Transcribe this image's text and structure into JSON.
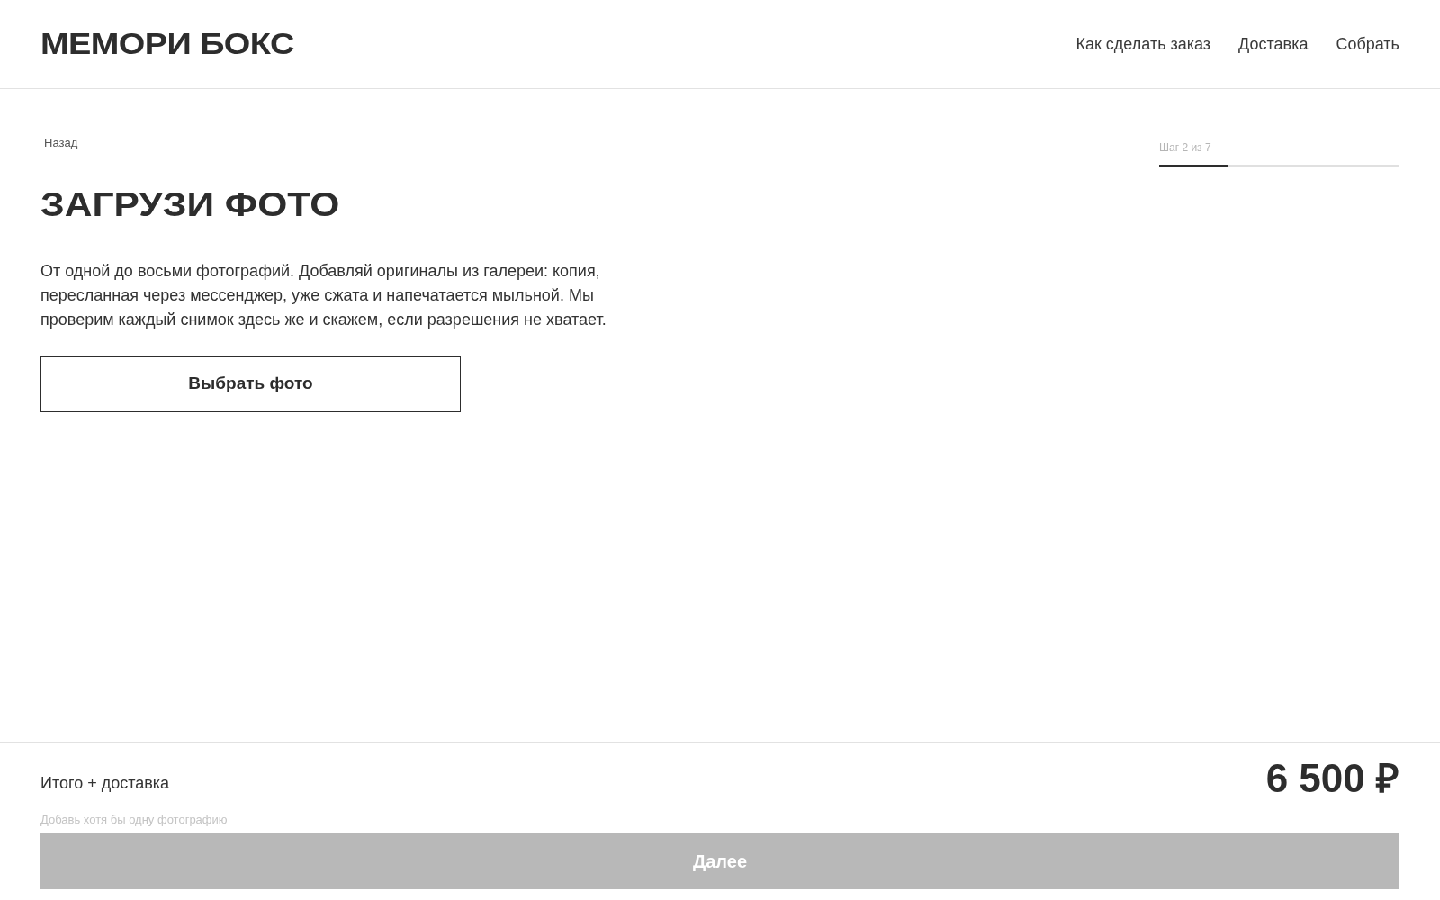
{
  "header": {
    "logo": "МЕМОРИ БОКС",
    "nav": [
      "Как сделать заказ",
      "Доставка",
      "Собрать"
    ]
  },
  "back_link": "Назад",
  "progress": {
    "label": "Шаг 2 из 7",
    "level": 0.2857
  },
  "title": "ЗАГРУЗИ ФОТО",
  "description": "От одной до восьми фотографий. Добавляй оригиналы из галереи: копия, пересланная через мессенджер, уже сжата и напечатается мыльной. Мы проверим каждый снимок здесь же и скажем, если разрешения не хватает.",
  "choose_button": "Выбрать фото",
  "footer": {
    "total_label": "Итого + доставка",
    "price": "6 500 ₽",
    "hint": "Добавь хотя бы одну фотографию",
    "next_button": {
      "label": "Далее",
      "disabled": true
    }
  }
}
